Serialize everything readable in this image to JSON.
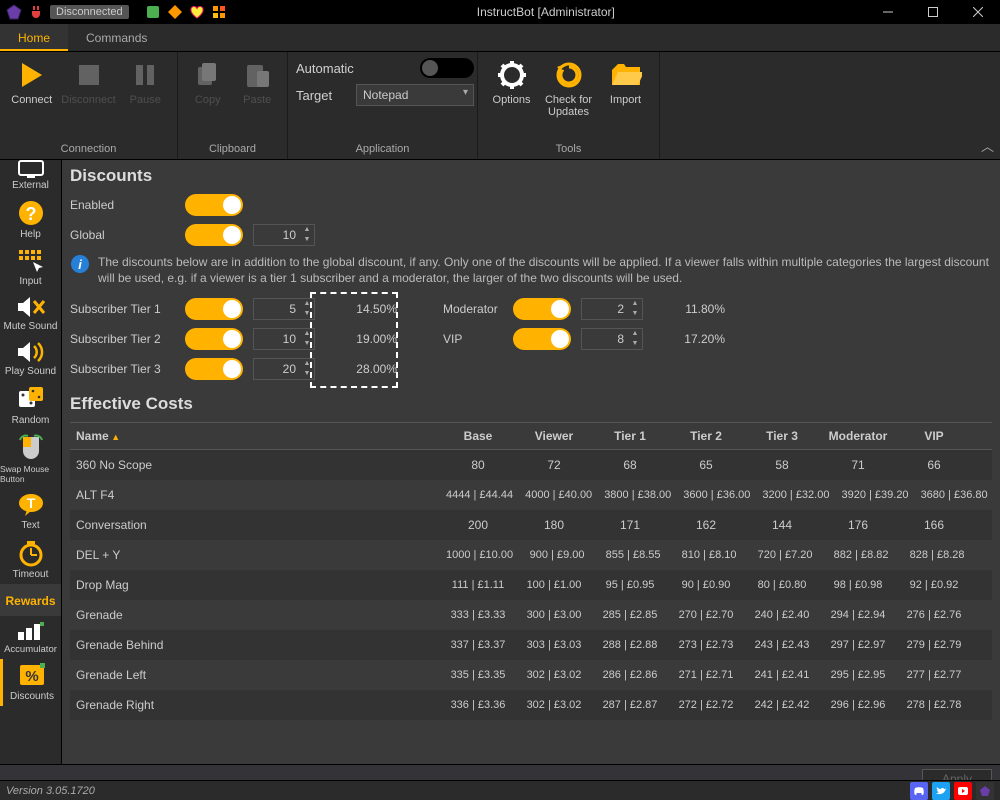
{
  "titlebar": {
    "status": "Disconnected",
    "windowTitle": "InstructBot [Administrator]"
  },
  "tabs": {
    "home": "Home",
    "commands": "Commands",
    "active": "home"
  },
  "ribbon": {
    "connect": "Connect",
    "disconnect": "Disconnect",
    "pause": "Pause",
    "copy": "Copy",
    "paste": "Paste",
    "automaticLabel": "Automatic",
    "targetLabel": "Target",
    "targetValue": "Notepad",
    "options": "Options",
    "checkUpdates": "Check for Updates",
    "import": "Import",
    "groups": {
      "connection": "Connection",
      "clipboard": "Clipboard",
      "application": "Application",
      "tools": "Tools"
    }
  },
  "sidebar": {
    "items": [
      {
        "id": "external",
        "label": "External"
      },
      {
        "id": "help",
        "label": "Help"
      },
      {
        "id": "input",
        "label": "Input"
      },
      {
        "id": "mute",
        "label": "Mute Sound"
      },
      {
        "id": "play",
        "label": "Play Sound"
      },
      {
        "id": "random",
        "label": "Random"
      },
      {
        "id": "swap",
        "label": "Swap Mouse Button"
      },
      {
        "id": "text",
        "label": "Text"
      },
      {
        "id": "timeout",
        "label": "Timeout"
      },
      {
        "id": "rewards",
        "label": "Rewards"
      },
      {
        "id": "accumulator",
        "label": "Accumulator"
      },
      {
        "id": "discounts",
        "label": "Discounts"
      }
    ],
    "active": "rewards"
  },
  "discounts": {
    "heading": "Discounts",
    "enabledLabel": "Enabled",
    "globalLabel": "Global",
    "globalValue": "10",
    "info": "The discounts below are in addition to the global discount, if any. Only one of the discounts will be applied. If a viewer falls within multiple categories the largest discount will be used, e.g. if a viewer is a tier 1 subscriber and a moderator, the larger of the two discounts will be used.",
    "tiers": {
      "t1": {
        "label": "Subscriber Tier 1",
        "value": "5",
        "pct": "14.50%"
      },
      "t2": {
        "label": "Subscriber Tier 2",
        "value": "10",
        "pct": "19.00%"
      },
      "t3": {
        "label": "Subscriber Tier 3",
        "value": "20",
        "pct": "28.00%"
      }
    },
    "roles": {
      "mod": {
        "label": "Moderator",
        "value": "2",
        "pct": "11.80%"
      },
      "vip": {
        "label": "VIP",
        "value": "8",
        "pct": "17.20%"
      }
    }
  },
  "effective": {
    "heading": "Effective Costs",
    "columns": [
      "Name",
      "Base",
      "Viewer",
      "Tier 1",
      "Tier 2",
      "Tier 3",
      "Moderator",
      "VIP"
    ],
    "rows": [
      {
        "name": "360 No Scope",
        "cells": [
          "80",
          "72",
          "68",
          "65",
          "58",
          "71",
          "66"
        ]
      },
      {
        "name": "ALT F4",
        "cells": [
          "4444 | £44.44",
          "4000 | £40.00",
          "3800 | £38.00",
          "3600 | £36.00",
          "3200 | £32.00",
          "3920 | £39.20",
          "3680 | £36.80"
        ]
      },
      {
        "name": "Conversation",
        "cells": [
          "200",
          "180",
          "171",
          "162",
          "144",
          "176",
          "166"
        ]
      },
      {
        "name": "DEL + Y",
        "cells": [
          "1000 | £10.00",
          "900 | £9.00",
          "855 | £8.55",
          "810 | £8.10",
          "720 | £7.20",
          "882 | £8.82",
          "828 | £8.28"
        ]
      },
      {
        "name": "Drop Mag",
        "cells": [
          "111 | £1.11",
          "100 | £1.00",
          "95 | £0.95",
          "90 | £0.90",
          "80 | £0.80",
          "98 | £0.98",
          "92 | £0.92"
        ]
      },
      {
        "name": "Grenade",
        "cells": [
          "333 | £3.33",
          "300 | £3.00",
          "285 | £2.85",
          "270 | £2.70",
          "240 | £2.40",
          "294 | £2.94",
          "276 | £2.76"
        ]
      },
      {
        "name": "Grenade Behind",
        "cells": [
          "337 | £3.37",
          "303 | £3.03",
          "288 | £2.88",
          "273 | £2.73",
          "243 | £2.43",
          "297 | £2.97",
          "279 | £2.79"
        ]
      },
      {
        "name": "Grenade Left",
        "cells": [
          "335 | £3.35",
          "302 | £3.02",
          "286 | £2.86",
          "271 | £2.71",
          "241 | £2.41",
          "295 | £2.95",
          "277 | £2.77"
        ]
      },
      {
        "name": "Grenade Right",
        "cells": [
          "336 | £3.36",
          "302 | £3.02",
          "287 | £2.87",
          "272 | £2.72",
          "242 | £2.42",
          "296 | £2.96",
          "278 | £2.78"
        ]
      }
    ]
  },
  "apply": "Apply",
  "version": "Version 3.05.1720"
}
